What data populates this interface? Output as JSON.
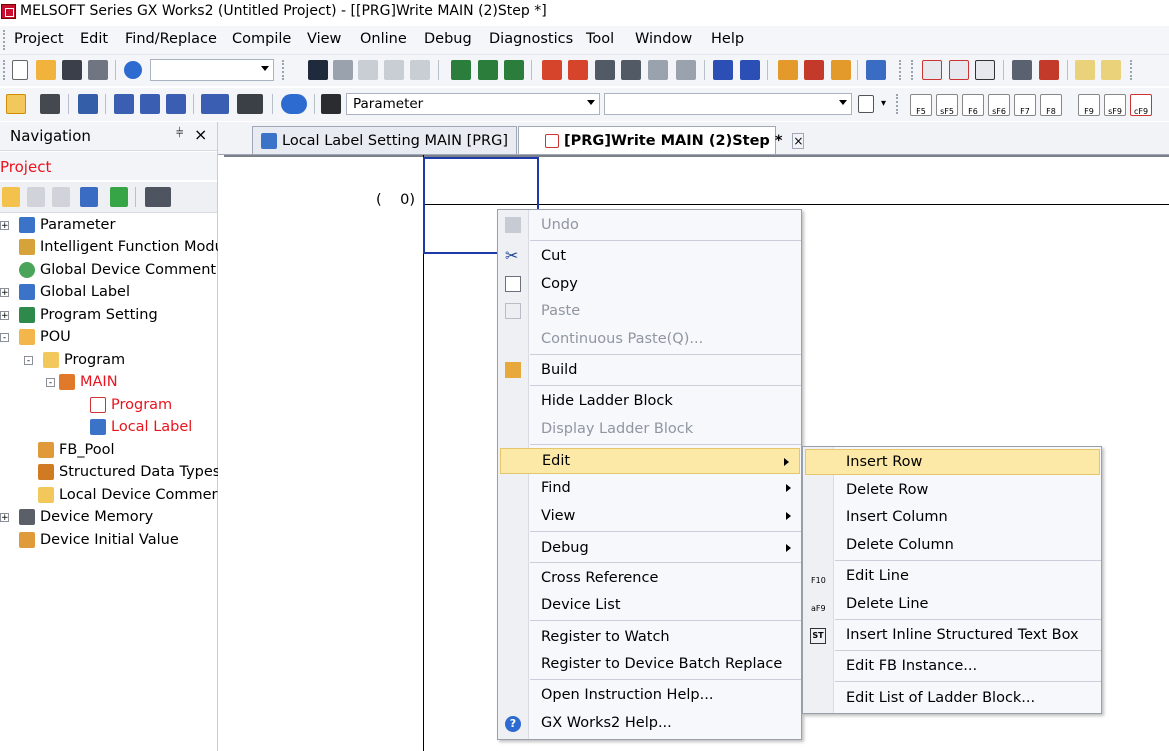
{
  "window": {
    "title": "MELSOFT Series GX Works2 (Untitled Project) - [[PRG]Write MAIN (2)Step *]"
  },
  "menubar": {
    "items": [
      "Project",
      "Edit",
      "Find/Replace",
      "Compile",
      "View",
      "Online",
      "Debug",
      "Diagnostics",
      "Tool",
      "Window",
      "Help"
    ]
  },
  "toolbar": {
    "combo1_value": "",
    "combo2_value": "Parameter",
    "combo3_value": "",
    "ladder_keys": [
      "F5",
      "sF5",
      "F6",
      "sF6",
      "F7",
      "F8",
      "F9",
      "sF9",
      "cF9"
    ]
  },
  "navigation": {
    "title": "Navigation",
    "pin": "1",
    "close": "×",
    "project_label": "Project",
    "tree": [
      {
        "label": "Parameter",
        "indent": 0,
        "exp": "+",
        "color": "normal"
      },
      {
        "label": "Intelligent Function Modu",
        "indent": 0,
        "exp": "",
        "color": "normal"
      },
      {
        "label": "Global Device Comment",
        "indent": 0,
        "exp": "",
        "color": "normal"
      },
      {
        "label": "Global Label",
        "indent": 0,
        "exp": "+",
        "color": "normal"
      },
      {
        "label": "Program Setting",
        "indent": 0,
        "exp": "+",
        "color": "normal"
      },
      {
        "label": "POU",
        "indent": 0,
        "exp": "-",
        "color": "normal"
      },
      {
        "label": "Program",
        "indent": 1,
        "exp": "-",
        "color": "normal"
      },
      {
        "label": "MAIN",
        "indent": 2,
        "exp": "-",
        "color": "red"
      },
      {
        "label": "Program",
        "indent": 3,
        "exp": "",
        "color": "red"
      },
      {
        "label": "Local Label",
        "indent": 3,
        "exp": "",
        "color": "red"
      },
      {
        "label": "FB_Pool",
        "indent": 1,
        "exp": "",
        "color": "normal"
      },
      {
        "label": "Structured Data Types",
        "indent": 1,
        "exp": "",
        "color": "normal"
      },
      {
        "label": "Local Device Commer",
        "indent": 1,
        "exp": "",
        "color": "normal"
      },
      {
        "label": "Device Memory",
        "indent": 0,
        "exp": "+",
        "color": "normal"
      },
      {
        "label": "Device Initial Value",
        "indent": 0,
        "exp": "",
        "color": "normal"
      }
    ]
  },
  "tabs": [
    {
      "label": "Local Label Setting MAIN [PRG]",
      "active": false
    },
    {
      "label": "[PRG]Write MAIN (2)Step *",
      "active": true
    }
  ],
  "ladder": {
    "step_label": "(    0)"
  },
  "context_menu": {
    "items": [
      {
        "label": "Undo",
        "disabled": true,
        "icon": "undo-icon"
      },
      {
        "label": "Cut",
        "disabled": false,
        "icon": "cut-icon"
      },
      {
        "label": "Copy",
        "disabled": false,
        "icon": "copy-icon"
      },
      {
        "label": "Paste",
        "disabled": true,
        "icon": "paste-icon"
      },
      {
        "label": "Continuous Paste(Q)...",
        "disabled": true,
        "icon": ""
      },
      {
        "label": "Build",
        "disabled": false,
        "icon": "build-icon"
      },
      {
        "label": "Hide Ladder Block",
        "disabled": false,
        "icon": ""
      },
      {
        "label": "Display Ladder Block",
        "disabled": true,
        "icon": ""
      },
      {
        "label": "Edit",
        "disabled": false,
        "submenu": true,
        "highlighted": true
      },
      {
        "label": "Find",
        "disabled": false,
        "submenu": true
      },
      {
        "label": "View",
        "disabled": false,
        "submenu": true
      },
      {
        "label": "Debug",
        "disabled": false,
        "submenu": true
      },
      {
        "label": "Cross Reference",
        "disabled": false
      },
      {
        "label": "Device List",
        "disabled": false
      },
      {
        "label": "Register to Watch",
        "disabled": false
      },
      {
        "label": "Register to Device Batch Replace",
        "disabled": false
      },
      {
        "label": "Open Instruction Help...",
        "disabled": false
      },
      {
        "label": "GX Works2 Help...",
        "disabled": false,
        "icon": "help-icon"
      }
    ]
  },
  "submenu": {
    "items": [
      {
        "label": "Insert Row",
        "highlighted": true
      },
      {
        "label": "Delete Row"
      },
      {
        "label": "Insert Column"
      },
      {
        "label": "Delete Column"
      },
      {
        "label": "Edit Line",
        "key": "F10"
      },
      {
        "label": "Delete Line",
        "key": "aF9"
      },
      {
        "label": "Insert Inline Structured Text Box",
        "key": "ST"
      },
      {
        "label": "Edit FB Instance..."
      },
      {
        "label": "Edit List of Ladder Block..."
      }
    ]
  },
  "colors": {
    "accent_red": "#e8141e",
    "menu_highlight": "#fde9a7",
    "ladder_blue": "#1c3aa9"
  }
}
